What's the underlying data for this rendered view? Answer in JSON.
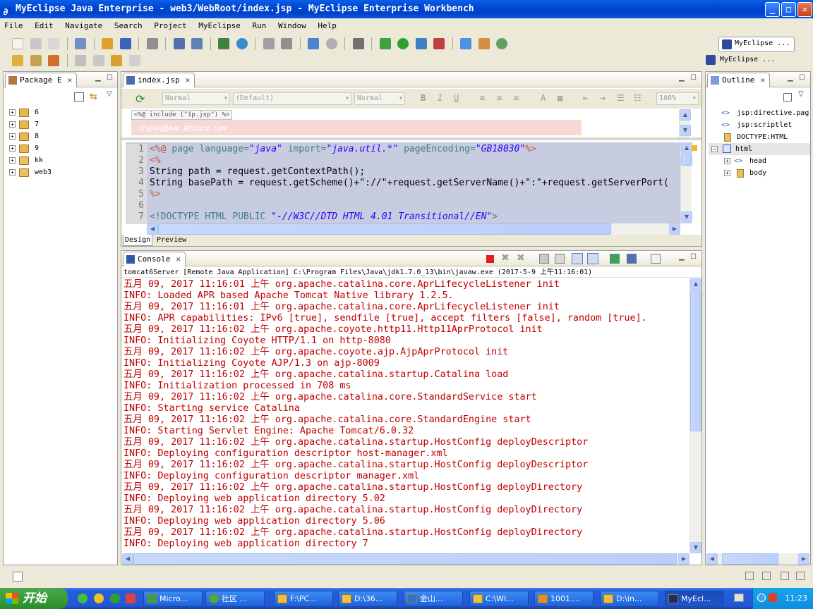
{
  "window": {
    "title": "MyEclipse Java Enterprise - web3/WebRoot/index.jsp - MyEclipse Enterprise Workbench",
    "minimize": "_",
    "maximize": "□",
    "close": "✕"
  },
  "menu": [
    "File",
    "Edit",
    "Navigate",
    "Search",
    "Project",
    "MyEclipse",
    "Run",
    "Window",
    "Help"
  ],
  "perspectives": {
    "primary": "MyEclipse ...",
    "secondary": "MyEclipse ..."
  },
  "package_explorer": {
    "title": "Package E",
    "items": [
      "6",
      "7",
      "8",
      "9",
      "kk",
      "web3"
    ]
  },
  "editor": {
    "tab": "index.jsp",
    "toolbar": {
      "style": "Normal",
      "font": "(Default)",
      "size": "Normal",
      "bold": "B",
      "italic": "I",
      "underline": "U",
      "zoom": "100%"
    },
    "preview_include": "<%@ include (\"1p.jsp\") %>",
    "watermark": "红动中国WWW.REDOCN.COM",
    "line_numbers": [
      "1",
      "2",
      "3",
      "4",
      "5",
      "6",
      "7"
    ],
    "lines": [
      {
        "p1": "<%@ ",
        "kw": "page ",
        "a1": "language=",
        "s1": "\"java\" ",
        "a2": "import=",
        "s2": "\"java.util.*\" ",
        "a3": "pageEncoding=",
        "s3": "\"GB18030\"",
        "end": "%>"
      },
      {
        "text": "<%"
      },
      {
        "text": "String path = request.getContextPath();"
      },
      {
        "text": "String basePath = request.getScheme()+\"://\"+request.getServerName()+\":\"+request.getServerPort("
      },
      {
        "text": "%>"
      },
      {
        "text": ""
      },
      {
        "p1": "<!DOCTYPE HTML PUBLIC ",
        "s1": "\"-//W3C//DTD HTML 4.01 Transitional//EN\"",
        "end": ">"
      }
    ],
    "bottom_tabs": [
      "Design",
      "Preview"
    ]
  },
  "outline": {
    "title": "Outline",
    "items": [
      {
        "label": "jsp:directive.pag",
        "depth": 0
      },
      {
        "label": "jsp:scriptlet",
        "depth": 0
      },
      {
        "label": "DOCTYPE:HTML",
        "depth": 0
      },
      {
        "label": "html",
        "depth": 0
      },
      {
        "label": "head",
        "depth": 1
      },
      {
        "label": "body",
        "depth": 1
      }
    ]
  },
  "console": {
    "tab": "Console",
    "process": "tomcat6Server [Remote Java Application] C:\\Program Files\\Java\\jdk1.7.0_13\\bin\\javaw.exe (2017-5-9 上午11:16:01)",
    "lines": [
      "五月 09, 2017 11:16:01 上午 org.apache.catalina.core.AprLifecycleListener init",
      "INFO: Loaded APR based Apache Tomcat Native library 1.2.5.",
      "五月 09, 2017 11:16:01 上午 org.apache.catalina.core.AprLifecycleListener init",
      "INFO: APR capabilities: IPv6 [true], sendfile [true], accept filters [false], random [true].",
      "五月 09, 2017 11:16:02 上午 org.apache.coyote.http11.Http11AprProtocol init",
      "INFO: Initializing Coyote HTTP/1.1 on http-8080",
      "五月 09, 2017 11:16:02 上午 org.apache.coyote.ajp.AjpAprProtocol init",
      "INFO: Initializing Coyote AJP/1.3 on ajp-8009",
      "五月 09, 2017 11:16:02 上午 org.apache.catalina.startup.Catalina load",
      "INFO: Initialization processed in 708 ms",
      "五月 09, 2017 11:16:02 上午 org.apache.catalina.core.StandardService start",
      "INFO: Starting service Catalina",
      "五月 09, 2017 11:16:02 上午 org.apache.catalina.core.StandardEngine start",
      "INFO: Starting Servlet Engine: Apache Tomcat/6.0.32",
      "五月 09, 2017 11:16:02 上午 org.apache.catalina.startup.HostConfig deployDescriptor",
      "INFO: Deploying configuration descriptor host-manager.xml",
      "五月 09, 2017 11:16:02 上午 org.apache.catalina.startup.HostConfig deployDescriptor",
      "INFO: Deploying configuration descriptor manager.xml",
      "五月 09, 2017 11:16:02 上午 org.apache.catalina.startup.HostConfig deployDirectory",
      "INFO: Deploying web application directory 5.02",
      "五月 09, 2017 11:16:02 上午 org.apache.catalina.startup.HostConfig deployDirectory",
      "INFO: Deploying web application directory 5.06",
      "五月 09, 2017 11:16:02 上午 org.apache.catalina.startup.HostConfig deployDirectory",
      "INFO: Deploying web application directory 7"
    ]
  },
  "taskbar": {
    "start": "开始",
    "tasks": [
      "Micro...",
      "社区 ...",
      "F:\\PC...",
      "D:\\36...",
      "金山...",
      "C:\\WI...",
      "1001....",
      "D:\\in...",
      "MyEcl..."
    ],
    "clock": "11:23"
  },
  "colors": {
    "titlebar": "#0047d3",
    "console_text": "#c00000",
    "taskbar": "#245edb"
  }
}
